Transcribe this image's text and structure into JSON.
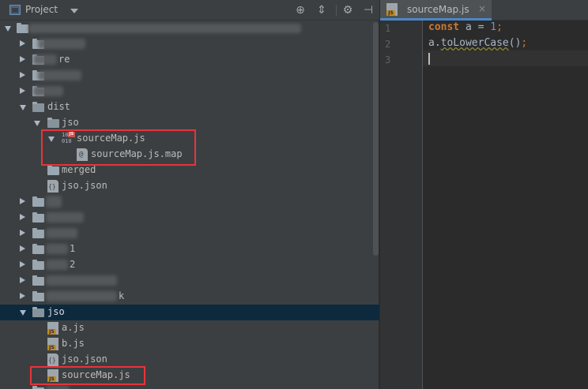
{
  "project_panel": {
    "title": "Project",
    "header_icons": [
      "target-icon",
      "collapse-icon",
      "gear-icon",
      "hide-icon"
    ],
    "tree": [
      {
        "label": "",
        "depth": 0,
        "type": "folder",
        "expanded": true,
        "redacted": true
      },
      {
        "label": "",
        "depth": 1,
        "type": "folder",
        "expanded": false,
        "redacted": true
      },
      {
        "label": "re",
        "depth": 1,
        "type": "folder",
        "expanded": false,
        "partially_redacted": true
      },
      {
        "label": "",
        "depth": 1,
        "type": "folder",
        "expanded": false,
        "redacted": true
      },
      {
        "label": "",
        "depth": 1,
        "type": "folder",
        "expanded": false,
        "redacted": true
      },
      {
        "label": "dist",
        "depth": 1,
        "type": "folder",
        "expanded": true
      },
      {
        "label": "jso",
        "depth": 2,
        "type": "folder",
        "expanded": true
      },
      {
        "label": "sourceMap.js",
        "depth": 3,
        "type": "binary-js",
        "expanded": true
      },
      {
        "label": "sourceMap.js.map",
        "depth": 4,
        "type": "map"
      },
      {
        "label": "merged",
        "depth": 2,
        "type": "folder"
      },
      {
        "label": "jso.json",
        "depth": 2,
        "type": "json"
      },
      {
        "label": "",
        "depth": 1,
        "type": "folder",
        "redacted": true
      },
      {
        "label": "",
        "depth": 1,
        "type": "folder",
        "redacted": true
      },
      {
        "label": "",
        "depth": 1,
        "type": "folder",
        "redacted": true
      },
      {
        "label": "1",
        "depth": 1,
        "type": "folder",
        "partially_redacted": true
      },
      {
        "label": "2",
        "depth": 1,
        "type": "folder",
        "partially_redacted": true
      },
      {
        "label": "",
        "depth": 1,
        "type": "folder",
        "redacted": true
      },
      {
        "label": "k",
        "depth": 1,
        "type": "folder",
        "partially_redacted": true
      },
      {
        "label": "jso",
        "depth": 1,
        "type": "folder",
        "expanded": true,
        "selected": true
      },
      {
        "label": "a.js",
        "depth": 2,
        "type": "js"
      },
      {
        "label": "b.js",
        "depth": 2,
        "type": "js"
      },
      {
        "label": "jso.json",
        "depth": 2,
        "type": "json"
      },
      {
        "label": "sourceMap.js",
        "depth": 2,
        "type": "js"
      }
    ]
  },
  "editor": {
    "tab_label": "sourceMap.js",
    "close_glyph": "×",
    "line_numbers": [
      "1",
      "2",
      "3"
    ],
    "code": {
      "line1": {
        "keyword": "const",
        "ident": " a = ",
        "number": "1",
        "semi": ";"
      },
      "line2": {
        "ident": "a.",
        "method": "toLowerCase",
        "parens": "()",
        "semi": ";"
      }
    }
  },
  "colors": {
    "highlight_box": "#e8333a",
    "selected_row": "#0d293e",
    "keyword": "#cc7832",
    "number": "#6897bb"
  }
}
